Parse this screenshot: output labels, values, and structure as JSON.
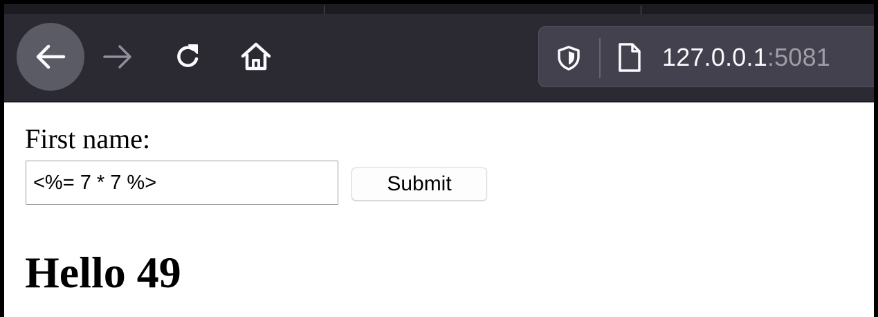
{
  "browser": {
    "url_host": "127.0.0.1",
    "url_port": ":5081",
    "toolbar_color": "#2b2a33",
    "icons": {
      "back": "back-arrow-icon",
      "forward": "forward-arrow-icon",
      "reload": "reload-icon",
      "home": "home-icon",
      "tracking": "shield-icon",
      "page": "page-icon"
    }
  },
  "form": {
    "label": "First name:",
    "input_value": "<%= 7 * 7 %>",
    "submit_label": "Submit"
  },
  "result": {
    "heading": "Hello 49"
  }
}
